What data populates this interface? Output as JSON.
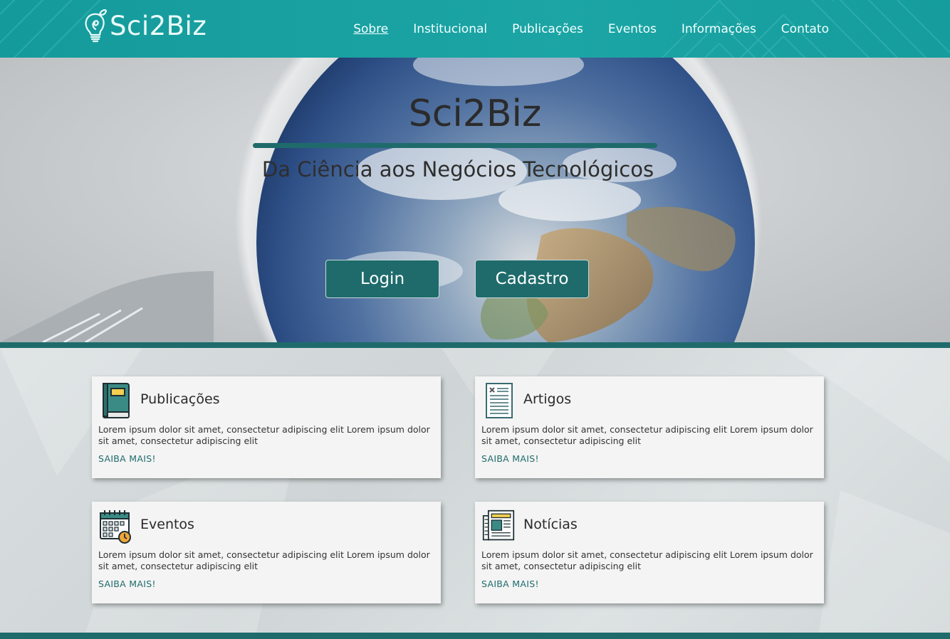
{
  "brand": {
    "logo_text": "Sci2Biz"
  },
  "nav": {
    "items": [
      {
        "label": "Sobre",
        "active": true
      },
      {
        "label": "Institucional",
        "active": false
      },
      {
        "label": "Publicações",
        "active": false
      },
      {
        "label": "Eventos",
        "active": false
      },
      {
        "label": "Informações",
        "active": false
      },
      {
        "label": "Contato",
        "active": false
      }
    ]
  },
  "hero": {
    "title": "Sci2Biz",
    "subtitle": "Da Ciência aos Negócios Tecnológicos",
    "login_label": "Login",
    "cadastro_label": "Cadastro"
  },
  "cards": [
    {
      "title": "Publicações",
      "icon": "book-icon",
      "text": "Lorem ipsum dolor sit amet, consectetur adipiscing elit Lorem ipsum dolor sit amet, consectetur adipiscing elit",
      "link": "SAIBA MAIS!"
    },
    {
      "title": "Artigos",
      "icon": "document-icon",
      "text": "Lorem ipsum dolor sit amet, consectetur adipiscing elit Lorem ipsum dolor sit amet, consectetur adipiscing elit",
      "link": "SAIBA MAIS!"
    },
    {
      "title": "Eventos",
      "icon": "calendar-icon",
      "text": "Lorem ipsum dolor sit amet, consectetur adipiscing elit Lorem ipsum dolor sit amet, consectetur adipiscing elit",
      "link": "SAIBA MAIS!"
    },
    {
      "title": "Notícias",
      "icon": "newspaper-icon",
      "text": "Lorem ipsum dolor sit amet, consectetur adipiscing elit Lorem ipsum dolor sit amet, consectetur adipiscing elit",
      "link": "SAIBA MAIS!"
    }
  ],
  "colors": {
    "nav_teal": "#1ca5a5",
    "dark_teal": "#1f6b6c",
    "card_bg": "#f4f4f4"
  }
}
